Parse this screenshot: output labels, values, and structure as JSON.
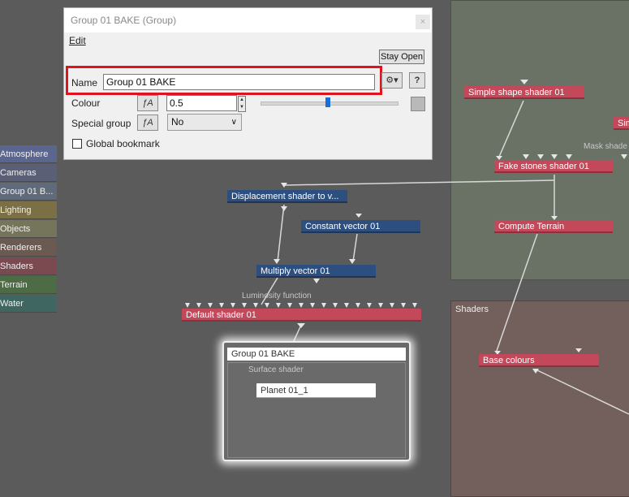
{
  "dialog": {
    "title": "Group 01 BAKE    (Group)",
    "close_label": "×",
    "menu_edit": "Edit",
    "stay_open": "Stay Open",
    "name_label": "Name",
    "name_value": "Group 01 BAKE",
    "settings_icon": "gear-icon",
    "help_label": "?",
    "colour_label": "Colour",
    "colour_value": "0.5",
    "colour_slider_fraction": 0.5,
    "special_group_label": "Special group",
    "special_group_value": "No",
    "global_bookmark_label": "Global bookmark",
    "global_bookmark_checked": false,
    "fx_button_label": "ƒA"
  },
  "categories": [
    {
      "label": "Atmosphere",
      "color": "#5a6590"
    },
    {
      "label": "Cameras",
      "color": "#5b5f75"
    },
    {
      "label": "Group 01 B...",
      "color": "#5f6a7a"
    },
    {
      "label": "Lighting",
      "color": "#7a6f45"
    },
    {
      "label": "Objects",
      "color": "#75755b"
    },
    {
      "label": "Renderers",
      "color": "#6b5a52"
    },
    {
      "label": "Shaders",
      "color": "#7a4a50"
    },
    {
      "label": "Terrain",
      "color": "#4d6b44"
    },
    {
      "label": "Water",
      "color": "#3f6660"
    }
  ],
  "nodes": {
    "simple_shape": "Simple shape shader 01",
    "sim_partial": "Sim",
    "mask_shader_label": "Mask shade",
    "fake_stones": "Fake stones shader 01",
    "compute_terrain": "Compute Terrain",
    "displacement": "Displacement shader to v...",
    "constant_vector": "Constant vector 01",
    "multiply_vector": "Multiply vector 01",
    "luminosity_label": "Luminosity function",
    "default_shader": "Default shader 01",
    "shaders_group": "Shaders",
    "base_colours": "Base colours",
    "bake_group": "Group 01 BAKE",
    "surface_shader_label": "Surface shader",
    "planet": "Planet 01_1"
  }
}
